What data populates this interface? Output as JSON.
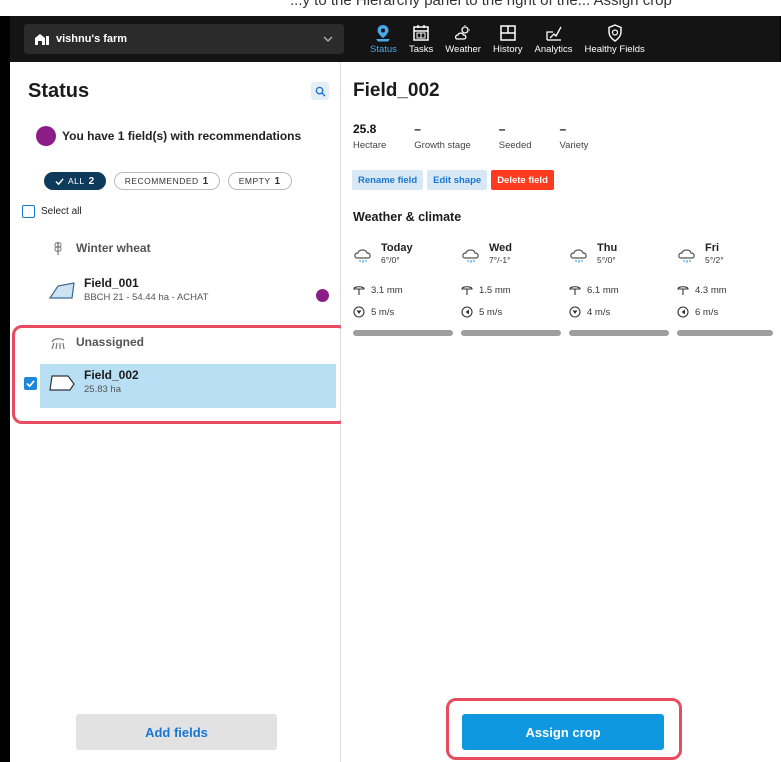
{
  "caption": "...y to the Hierarchy panel to the right of the... Assign crop",
  "header": {
    "farm_name": "vishnu's farm",
    "nav": [
      {
        "label": "Status",
        "icon": "map-pin-icon",
        "active": true
      },
      {
        "label": "Tasks",
        "icon": "calendar-icon"
      },
      {
        "label": "Weather",
        "icon": "weather-icon"
      },
      {
        "label": "History",
        "icon": "history-icon"
      },
      {
        "label": "Analytics",
        "icon": "analytics-icon"
      },
      {
        "label": "Healthy Fields",
        "icon": "shield-icon"
      }
    ]
  },
  "left": {
    "title": "Status",
    "recommendation_text": "You have 1 field(s) with recommendations",
    "filters": [
      {
        "label": "ALL",
        "count": "2",
        "active": true
      },
      {
        "label": "RECOMMENDED",
        "count": "1"
      },
      {
        "label": "EMPTY",
        "count": "1"
      }
    ],
    "select_all": "Select all",
    "group_winter_wheat": "Winter wheat",
    "field_001": {
      "name": "Field_001",
      "sub": "BBCH 21 - 54.44 ha - ACHAT"
    },
    "group_unassigned": "Unassigned",
    "field_002": {
      "name": "Field_002",
      "sub": "25.83 ha"
    },
    "add_fields": "Add fields"
  },
  "right": {
    "title": "Field_002",
    "stats": [
      {
        "value": "25.8",
        "label": "Hectare"
      },
      {
        "value": "–",
        "label": "Growth stage"
      },
      {
        "value": "–",
        "label": "Seeded"
      },
      {
        "value": "–",
        "label": "Variety"
      }
    ],
    "actions": {
      "rename": "Rename field",
      "edit": "Edit shape",
      "delete": "Delete field"
    },
    "weather_title": "Weather & climate",
    "weather": [
      {
        "day": "Today",
        "temp": "6°/0°",
        "rain": "3.1 mm",
        "wind": "5 m/s"
      },
      {
        "day": "Wed",
        "temp": "7°/-1°",
        "rain": "1.5 mm",
        "wind": "5 m/s"
      },
      {
        "day": "Thu",
        "temp": "5°/0°",
        "rain": "6.1 mm",
        "wind": "4 m/s"
      },
      {
        "day": "Fri",
        "temp": "5°/2°",
        "rain": "4.3 mm",
        "wind": "6 m/s"
      }
    ],
    "assign_crop": "Assign crop"
  }
}
